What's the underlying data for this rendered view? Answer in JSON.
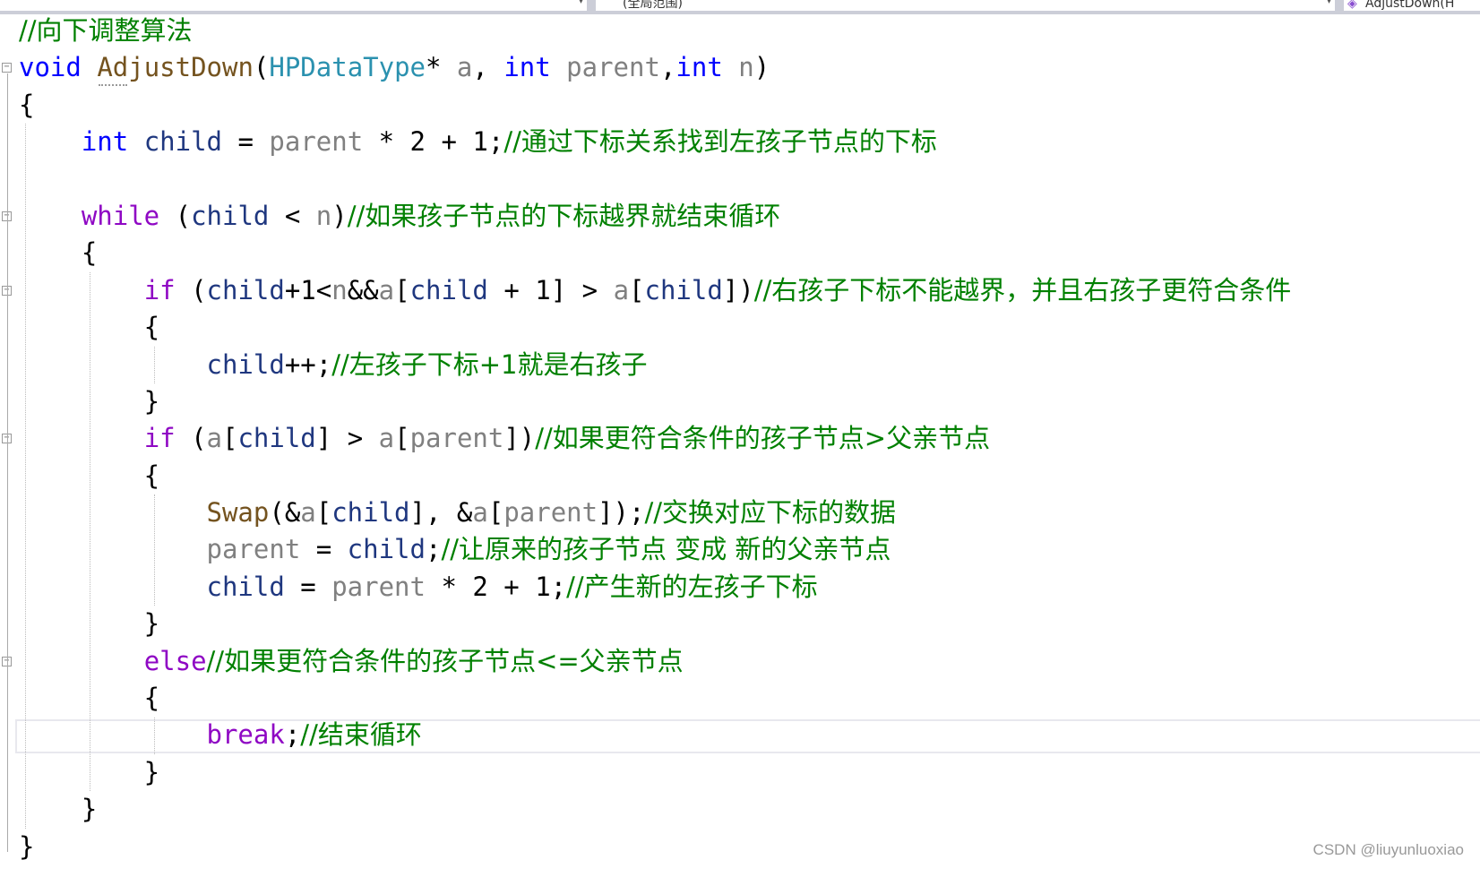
{
  "toolbar": {
    "scope_dropdown": "(全局范围)",
    "member_dropdown": "AdjustDown(H"
  },
  "colors": {
    "keyword": "#0000ff",
    "control": "#8f08c4",
    "type": "#2b91af",
    "function": "#74531f",
    "parameter": "#808080",
    "comment": "#008000",
    "local": "#1f377f"
  },
  "code": {
    "lines": [
      [
        [
          "//向下调整算法",
          "cm"
        ]
      ],
      [
        [
          "void",
          "kw"
        ],
        [
          " ",
          "pl"
        ],
        [
          "AdjustDown",
          "fn"
        ],
        [
          "(",
          "pl"
        ],
        [
          "HPDataType",
          "type"
        ],
        [
          "* ",
          "pl"
        ],
        [
          "a",
          "param"
        ],
        [
          ", ",
          "pl"
        ],
        [
          "int",
          "kw"
        ],
        [
          " ",
          "pl"
        ],
        [
          "parent",
          "param"
        ],
        [
          ",",
          "pl"
        ],
        [
          "int",
          "kw"
        ],
        [
          " ",
          "pl"
        ],
        [
          "n",
          "param"
        ],
        [
          ")",
          "pl"
        ]
      ],
      [
        [
          "{",
          "pl"
        ]
      ],
      [
        [
          "    ",
          "pl"
        ],
        [
          "int",
          "kw"
        ],
        [
          " ",
          "pl"
        ],
        [
          "child",
          "var"
        ],
        [
          " = ",
          "pl"
        ],
        [
          "parent",
          "param"
        ],
        [
          " * 2 + 1;",
          "pl"
        ],
        [
          "//通过下标关系找到左孩子节点的下标",
          "cm"
        ]
      ],
      [],
      [
        [
          "    ",
          "pl"
        ],
        [
          "while",
          "ctl"
        ],
        [
          " (",
          "pl"
        ],
        [
          "child",
          "var"
        ],
        [
          " < ",
          "pl"
        ],
        [
          "n",
          "param"
        ],
        [
          ")",
          "pl"
        ],
        [
          "//如果孩子节点的下标越界就结束循环",
          "cm"
        ]
      ],
      [
        [
          "    {",
          "pl"
        ]
      ],
      [
        [
          "        ",
          "pl"
        ],
        [
          "if",
          "ctl"
        ],
        [
          " (",
          "pl"
        ],
        [
          "child",
          "var"
        ],
        [
          "+1<",
          "pl"
        ],
        [
          "n",
          "param"
        ],
        [
          "&&",
          "pl"
        ],
        [
          "a",
          "param"
        ],
        [
          "[",
          "pl"
        ],
        [
          "child",
          "var"
        ],
        [
          " + 1] > ",
          "pl"
        ],
        [
          "a",
          "param"
        ],
        [
          "[",
          "pl"
        ],
        [
          "child",
          "var"
        ],
        [
          "])",
          "pl"
        ],
        [
          "//右孩子下标不能越界，并且右孩子更符合条件",
          "cm"
        ]
      ],
      [
        [
          "        {",
          "pl"
        ]
      ],
      [
        [
          "            ",
          "pl"
        ],
        [
          "child",
          "var"
        ],
        [
          "++;",
          "pl"
        ],
        [
          "//左孩子下标+1就是右孩子",
          "cm"
        ]
      ],
      [
        [
          "        }",
          "pl"
        ]
      ],
      [
        [
          "        ",
          "pl"
        ],
        [
          "if",
          "ctl"
        ],
        [
          " (",
          "pl"
        ],
        [
          "a",
          "param"
        ],
        [
          "[",
          "pl"
        ],
        [
          "child",
          "var"
        ],
        [
          "] > ",
          "pl"
        ],
        [
          "a",
          "param"
        ],
        [
          "[",
          "pl"
        ],
        [
          "parent",
          "param"
        ],
        [
          "])",
          "pl"
        ],
        [
          "//如果更符合条件的孩子节点>父亲节点",
          "cm"
        ]
      ],
      [
        [
          "        {",
          "pl"
        ]
      ],
      [
        [
          "            ",
          "pl"
        ],
        [
          "Swap",
          "fn"
        ],
        [
          "(&",
          "pl"
        ],
        [
          "a",
          "param"
        ],
        [
          "[",
          "pl"
        ],
        [
          "child",
          "var"
        ],
        [
          "], &",
          "pl"
        ],
        [
          "a",
          "param"
        ],
        [
          "[",
          "pl"
        ],
        [
          "parent",
          "param"
        ],
        [
          "]);",
          "pl"
        ],
        [
          "//交换对应下标的数据",
          "cm"
        ]
      ],
      [
        [
          "            ",
          "pl"
        ],
        [
          "parent",
          "param"
        ],
        [
          " = ",
          "pl"
        ],
        [
          "child",
          "var"
        ],
        [
          ";",
          "pl"
        ],
        [
          "//让原来的孩子节点 变成 新的父亲节点",
          "cm"
        ]
      ],
      [
        [
          "            ",
          "pl"
        ],
        [
          "child",
          "var"
        ],
        [
          " = ",
          "pl"
        ],
        [
          "parent",
          "param"
        ],
        [
          " * 2 + 1;",
          "pl"
        ],
        [
          "//产生新的左孩子下标",
          "cm"
        ]
      ],
      [
        [
          "        }",
          "pl"
        ]
      ],
      [
        [
          "        ",
          "pl"
        ],
        [
          "else",
          "ctl"
        ],
        [
          "//如果更符合条件的孩子节点<=父亲节点",
          "cm"
        ]
      ],
      [
        [
          "        {",
          "pl"
        ]
      ],
      [
        [
          "            ",
          "pl"
        ],
        [
          "break",
          "ctl"
        ],
        [
          ";",
          "pl"
        ],
        [
          "//结束循环",
          "cm"
        ]
      ],
      [
        [
          "        }",
          "pl"
        ]
      ],
      [
        [
          "    }",
          "pl"
        ]
      ],
      [
        [
          "}",
          "pl"
        ]
      ]
    ]
  },
  "watermark": "CSDN @liuyunluoxiao"
}
